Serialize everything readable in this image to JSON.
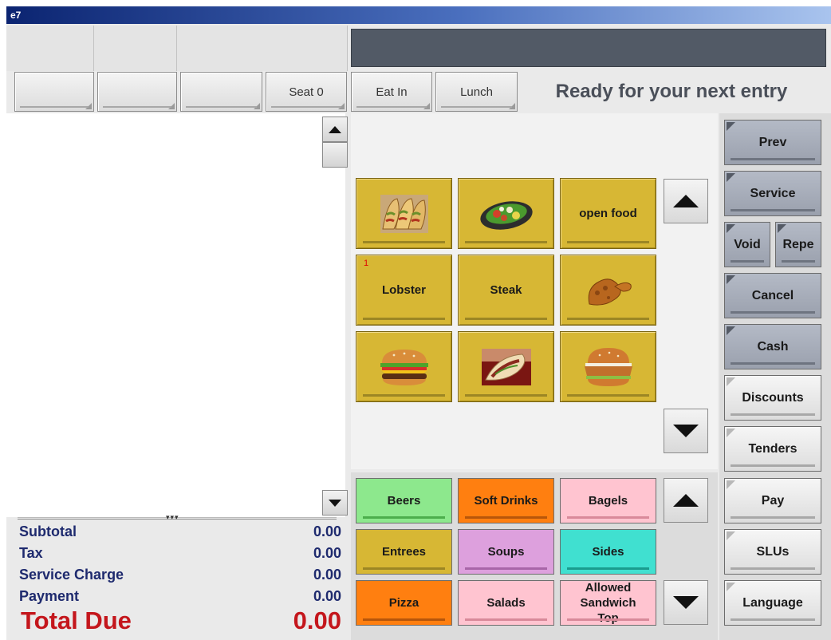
{
  "window": {
    "title": "e7"
  },
  "seat_bar": {
    "seat_label": "Seat 0",
    "order_type": "Eat In",
    "period": "Lunch"
  },
  "status": {
    "message": "Ready for your next entry"
  },
  "totals": {
    "subtotal_label": "Subtotal",
    "subtotal_value": "0.00",
    "tax_label": "Tax",
    "tax_value": "0.00",
    "service_label": "Service Charge",
    "service_value": "0.00",
    "payment_label": "Payment",
    "payment_value": "0.00",
    "total_label": "Total Due",
    "total_value": "0.00"
  },
  "menu_items": [
    {
      "icon": "tacos-icon",
      "label": ""
    },
    {
      "icon": "salad-icon",
      "label": ""
    },
    {
      "icon": "",
      "label": "open food"
    },
    {
      "icon": "",
      "label": "Lobster",
      "count": "1"
    },
    {
      "icon": "",
      "label": "Steak"
    },
    {
      "icon": "chicken-icon",
      "label": ""
    },
    {
      "icon": "cheeseburger-icon",
      "label": ""
    },
    {
      "icon": "wrap-icon",
      "label": ""
    },
    {
      "icon": "chicken-sandwich-icon",
      "label": ""
    }
  ],
  "categories": [
    {
      "label": "Beers",
      "color": "#8de88d",
      "bar": "#4cae4c"
    },
    {
      "label": "Soft Drinks",
      "color": "#ff7f10",
      "bar": "#b8560a"
    },
    {
      "label": "Bagels",
      "color": "#ffc4d0",
      "bar": "#d98a9a"
    },
    {
      "label": "Entrees",
      "color": "#d7b734",
      "bar": "#9c8624"
    },
    {
      "label": "Soups",
      "color": "#dda0dd",
      "bar": "#a866a8"
    },
    {
      "label": "Sides",
      "color": "#40e0d0",
      "bar": "#1a9c8e"
    },
    {
      "label": "Pizza",
      "color": "#ff7f10",
      "bar": "#b8560a"
    },
    {
      "label": "Salads",
      "color": "#ffc4d0",
      "bar": "#d98a9a"
    },
    {
      "label": "Allowed Sandwich Top",
      "color": "#ffc4d0",
      "bar": "#d98a9a"
    }
  ],
  "functions": {
    "prev": "Prev",
    "service": "Service",
    "void": "Void",
    "repeat": "Repe",
    "cancel": "Cancel",
    "cash": "Cash",
    "discounts": "Discounts",
    "tenders": "Tenders",
    "pay": "Pay",
    "slus": "SLUs",
    "language": "Language"
  }
}
